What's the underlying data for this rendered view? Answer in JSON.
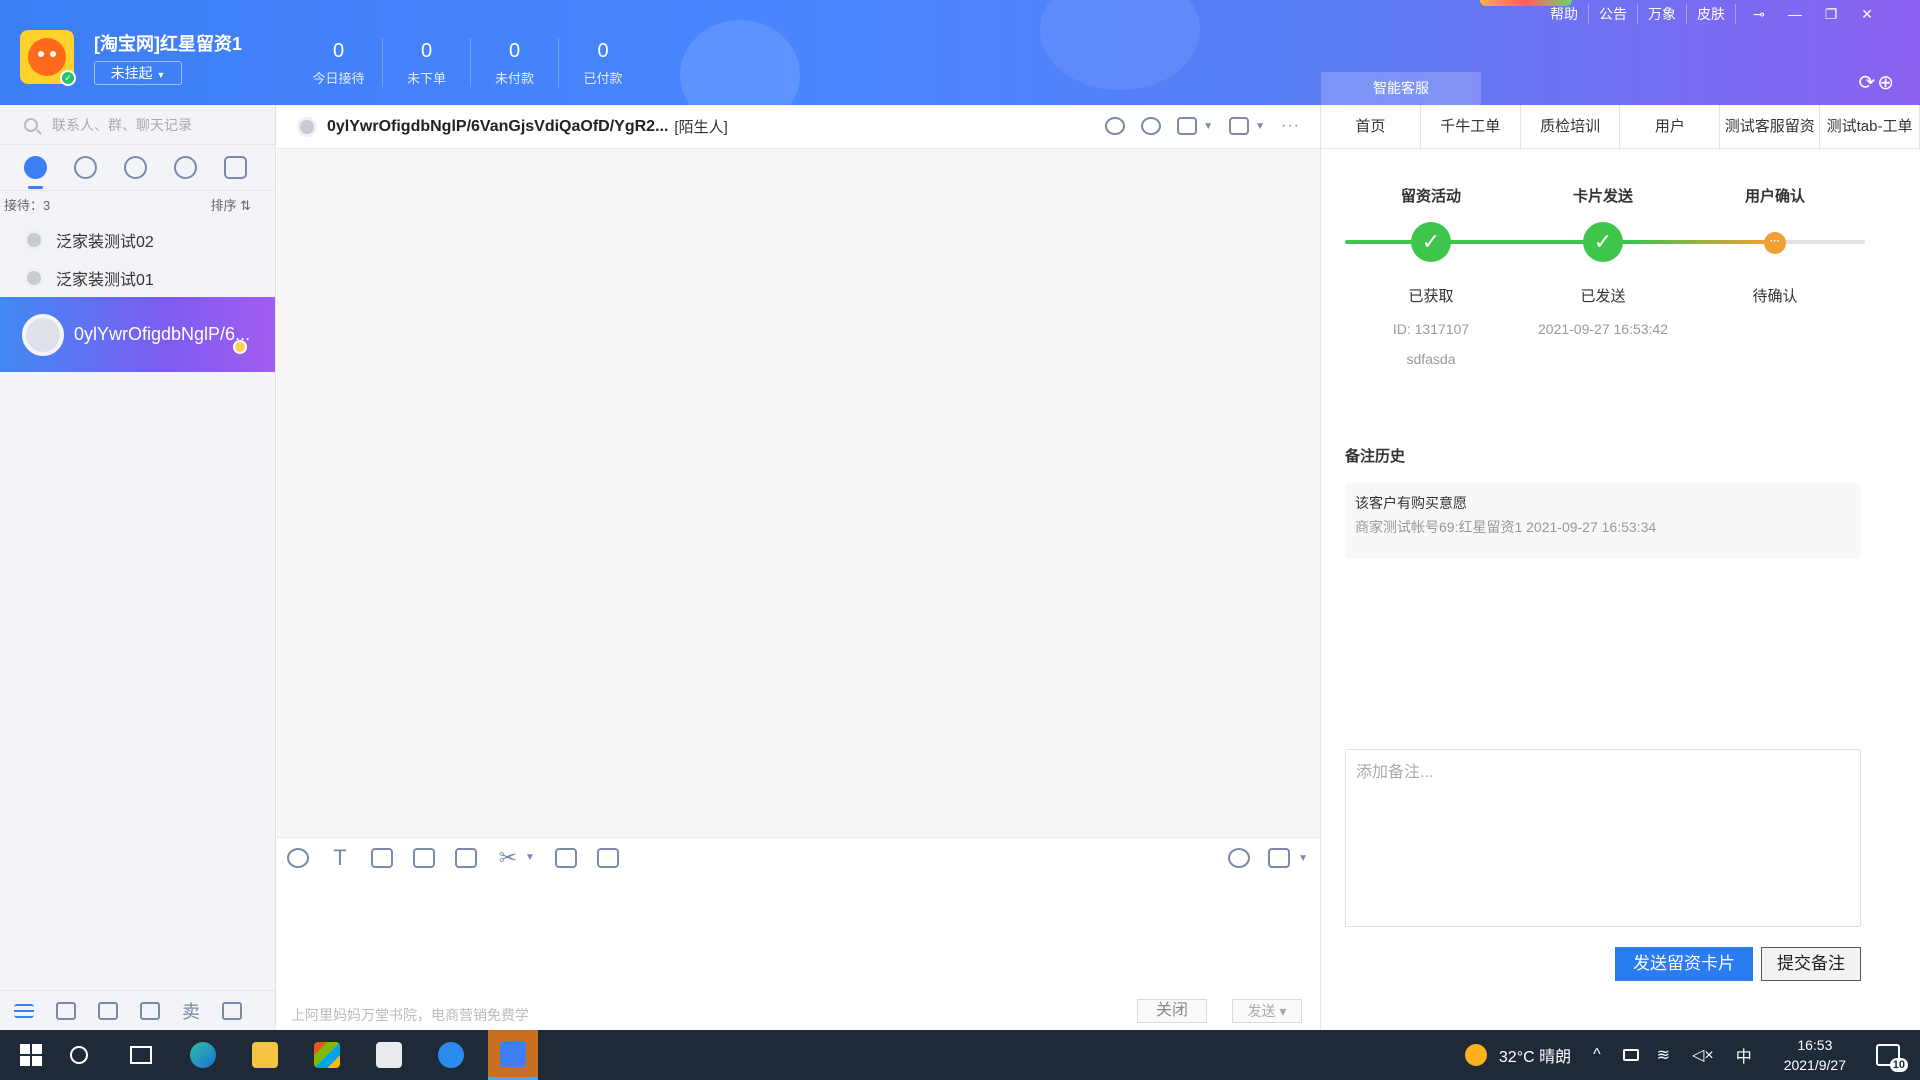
{
  "header": {
    "store_name": "[淘宝网]红星留资1",
    "status": "未挂起",
    "stats": [
      {
        "value": "0",
        "label": "今日接待"
      },
      {
        "value": "0",
        "label": "未下单"
      },
      {
        "value": "0",
        "label": "未付款"
      },
      {
        "value": "0",
        "label": "已付款"
      }
    ],
    "menu": [
      "帮助",
      "公告",
      "万象",
      "皮肤"
    ],
    "smart_tab": "智能客服"
  },
  "sidebar": {
    "search_placeholder": "联系人、群、聊天记录",
    "reception": "接待：3",
    "sort": "排序 ⇅",
    "contacts": [
      {
        "name": "泛家装测试02"
      },
      {
        "name": "泛家装测试01"
      },
      {
        "name": "0ylYwrOfigdbNglP/6..."
      }
    ],
    "bottom_text": "卖"
  },
  "chat": {
    "title": "0ylYwrOfigdbNglP/6VanGjsVdiQaOfD/YgR2...",
    "tag": "[陌生人]",
    "footer_ad": "上阿里妈妈万堂书院，电商营销免费学",
    "close_label": "关闭",
    "send_label": "发送 ▾"
  },
  "panel": {
    "tabs": [
      "首页",
      "千牛工单",
      "质检培训",
      "用户",
      "测试客服留资",
      "测试tab-工单"
    ],
    "steps": [
      {
        "title": "留资活动",
        "status": "已获取",
        "info": [
          "ID: 1317107",
          "sdfasda"
        ]
      },
      {
        "title": "卡片发送",
        "status": "已发送",
        "info": [
          "2021-09-27 16:53:42"
        ]
      },
      {
        "title": "用户确认",
        "status": "待确认",
        "info": []
      }
    ],
    "step_check": "✓",
    "step_pending": "···",
    "colors": {
      "done": "#3ec64b",
      "pending": "#f0a035",
      "line_todo": "#e2e2e2"
    },
    "notes_title": "备注历史",
    "notes": [
      {
        "text": "该客户有购买意愿",
        "meta": "商家测试帐号69:红星留资1 2021-09-27 16:53:34"
      }
    ],
    "note_placeholder": "添加备注...",
    "send_card_label": "发送留资卡片",
    "submit_note_label": "提交备注"
  },
  "taskbar": {
    "weather": "32°C  晴朗",
    "ime": "中",
    "time": "16:53",
    "date": "2021/9/27",
    "notifications": "10"
  }
}
